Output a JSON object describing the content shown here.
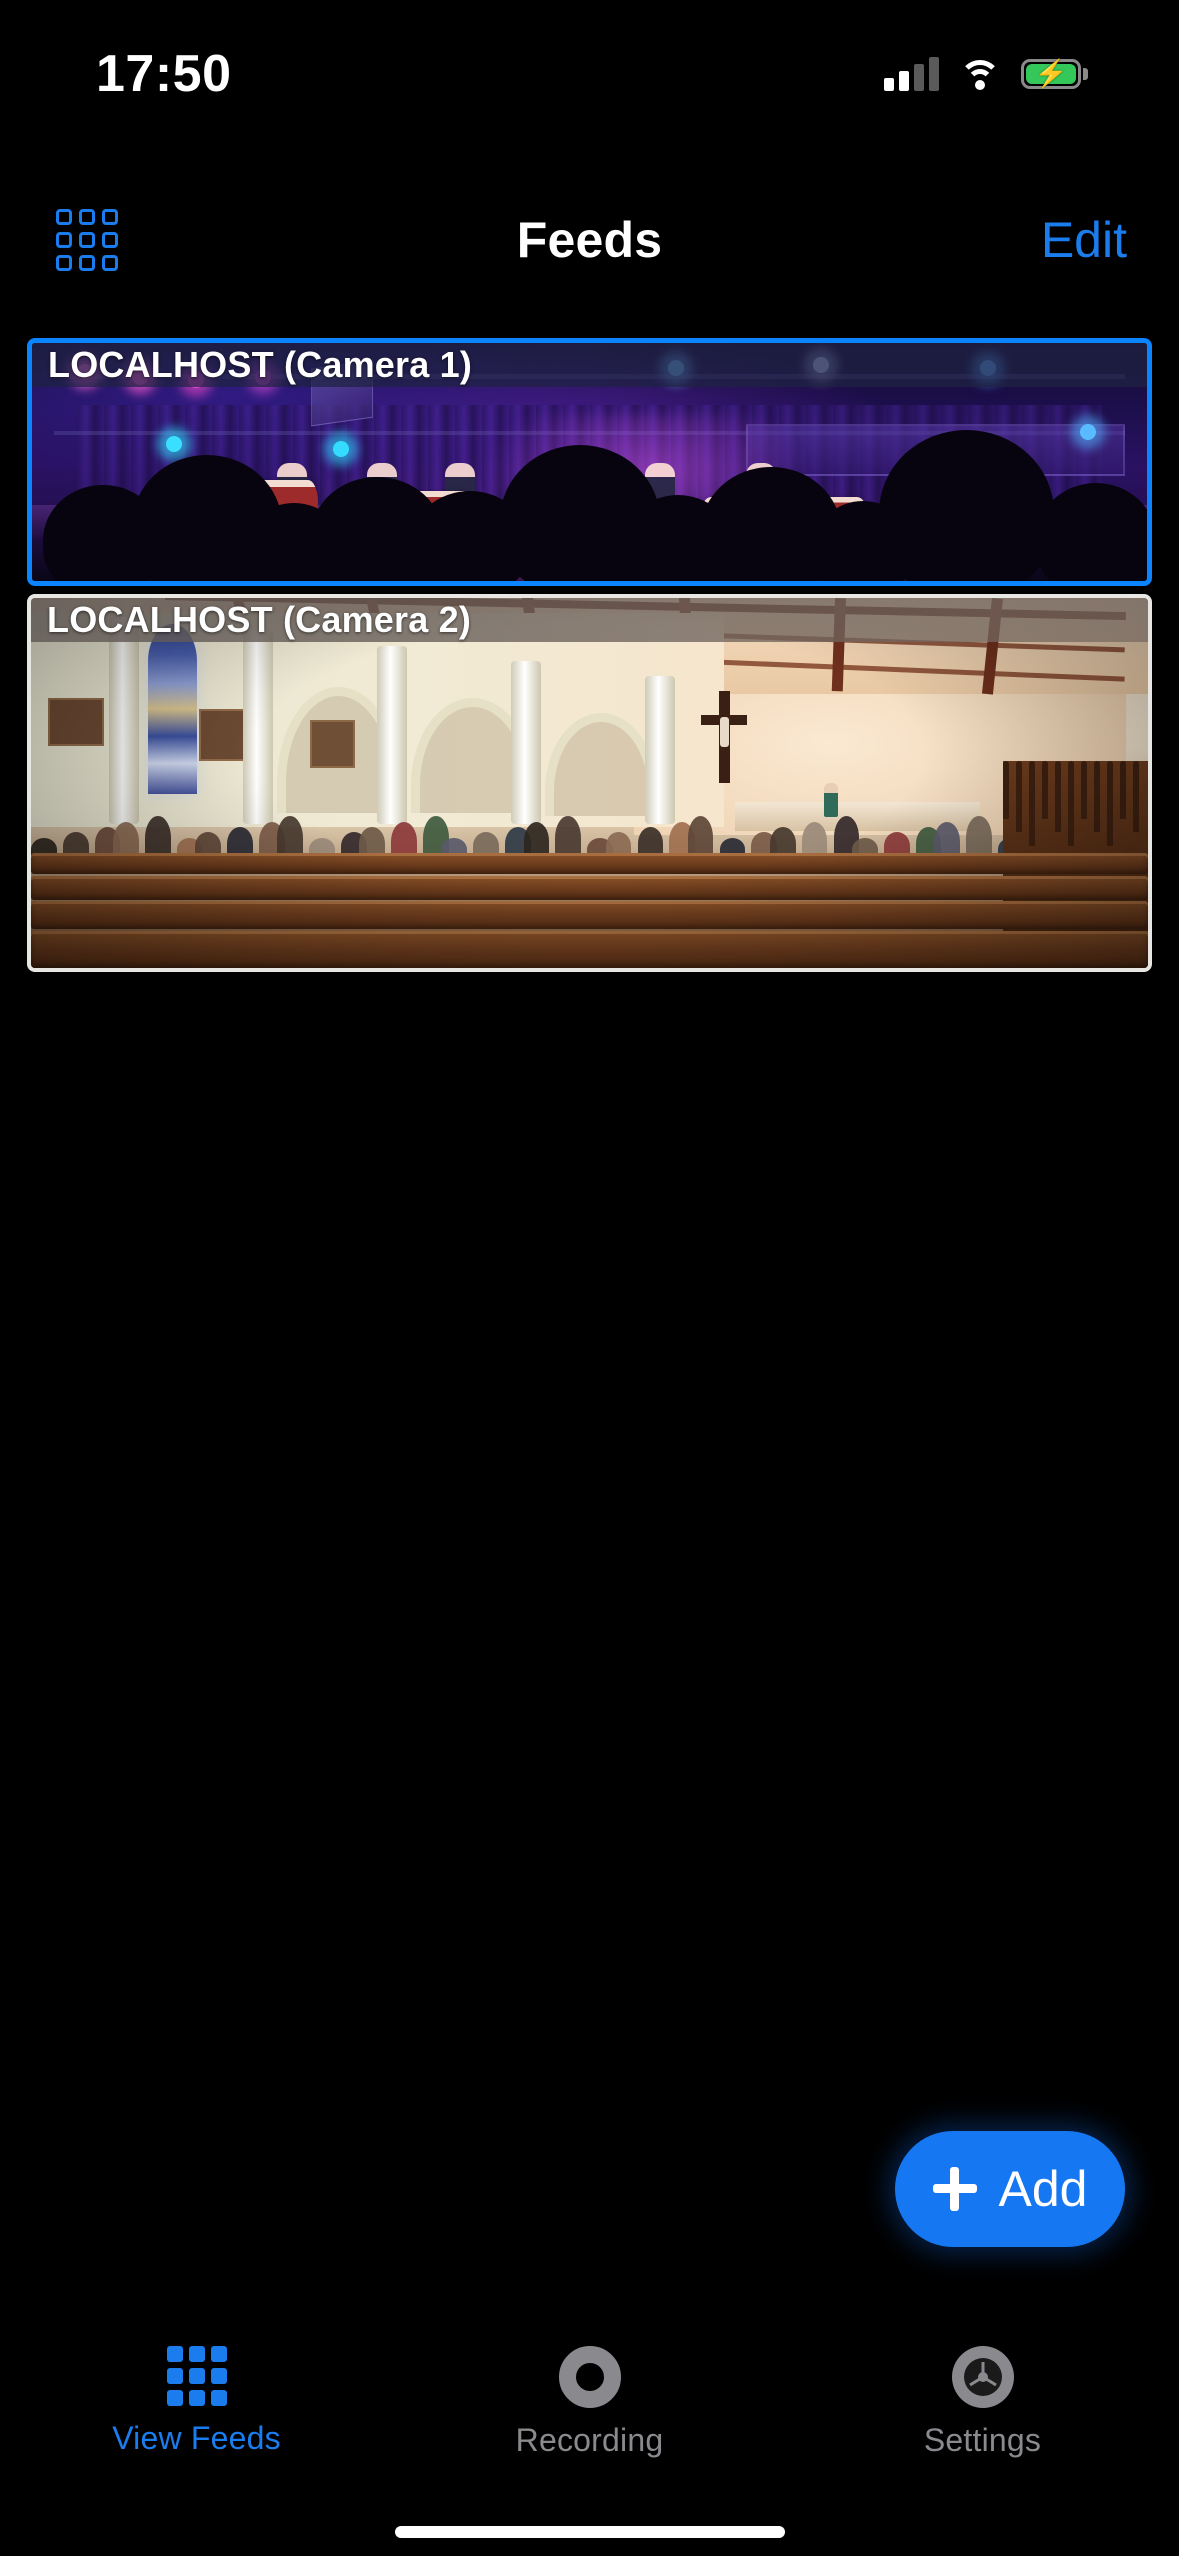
{
  "status_bar": {
    "time": "17:50",
    "cellular_icon": "cellular-signal-icon",
    "wifi_icon": "wifi-icon",
    "battery_icon": "battery-charging-icon",
    "battery_color": "#34c759"
  },
  "nav_bar": {
    "grid_icon": "grid-layout-icon",
    "title": "Feeds",
    "edit_label": "Edit",
    "accent_color": "#1b7ced"
  },
  "feeds": [
    {
      "label": "LOCALHOST (Camera 1)",
      "selected": true,
      "border_color": "#0a84ff",
      "scene": "dark theatre stage with purple and blue lighting, taiko drummers performing, silhouetted audience"
    },
    {
      "label": "LOCALHOST (Camera 2)",
      "selected": false,
      "border_color": "#e8e6e2",
      "scene": "church interior with gothic arches, stained glass window, crucifix, wooden pews and congregation"
    }
  ],
  "add_button": {
    "label": "Add",
    "plus_icon": "plus-icon",
    "color": "#1577f2"
  },
  "tab_bar": {
    "items": [
      {
        "label": "View Feeds",
        "icon": "grid-layout-icon",
        "active": true,
        "color": "#1b7ced"
      },
      {
        "label": "Recording",
        "icon": "record-circle-icon",
        "active": false,
        "color": "#8a8a8e"
      },
      {
        "label": "Settings",
        "icon": "gear-icon",
        "active": false,
        "color": "#8a8a8e"
      }
    ]
  }
}
